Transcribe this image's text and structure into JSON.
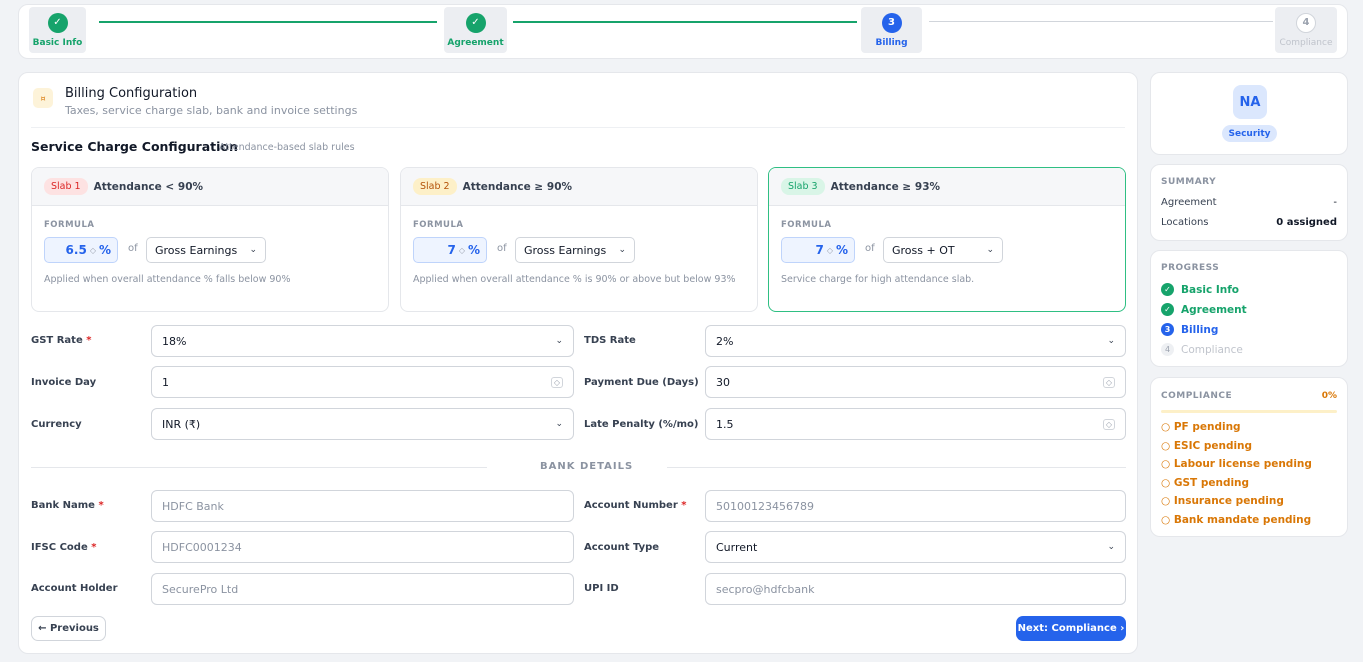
{
  "steps": [
    {
      "num": "✓",
      "label": "Basic Info",
      "state": "done"
    },
    {
      "num": "✓",
      "label": "Agreement",
      "state": "done"
    },
    {
      "num": "3",
      "label": "Billing",
      "state": "active"
    },
    {
      "num": "4",
      "label": "Compliance",
      "state": "todo"
    }
  ],
  "header": {
    "icon": "¤",
    "title": "Billing Configuration",
    "subtitle": "Taxes, service charge slab, bank and invoice settings"
  },
  "service_charge": {
    "title": "Service Charge Configuration",
    "subtitle": "Attendance-based slab rules",
    "formula_label": "FORMULA",
    "of_label": "of",
    "slabs": [
      {
        "badge": "Slab 1",
        "condition": "Attendance < 90%",
        "percent": "6.5",
        "unit": "%",
        "base": "Gross Earnings",
        "description": "Applied when overall attendance % falls below 90%"
      },
      {
        "badge": "Slab 2",
        "condition": "Attendance ≥ 90%",
        "percent": "7",
        "unit": "%",
        "base": "Gross Earnings",
        "description": "Applied when overall attendance % is 90% or above but below 93%"
      },
      {
        "badge": "Slab 3",
        "condition": "Attendance ≥ 93%",
        "percent": "7",
        "unit": "%",
        "base": "Gross + OT",
        "description": "Service charge for high attendance slab."
      }
    ]
  },
  "fields": {
    "gst_rate": {
      "label": "GST Rate",
      "value": "18%"
    },
    "tds_rate": {
      "label": "TDS Rate",
      "value": "2%"
    },
    "invoice_day": {
      "label": "Invoice Day",
      "value": "1"
    },
    "payment_due": {
      "label": "Payment Due (Days)",
      "value": "30"
    },
    "currency": {
      "label": "Currency",
      "value": "INR (₹)"
    },
    "late_penalty": {
      "label": "Late Penalty (%/mo)",
      "value": "1.5"
    }
  },
  "bank": {
    "title": "BANK DETAILS",
    "bank_name": {
      "label": "Bank Name",
      "placeholder": "HDFC Bank"
    },
    "account_number": {
      "label": "Account Number",
      "placeholder": "50100123456789"
    },
    "ifsc": {
      "label": "IFSC Code",
      "placeholder": "HDFC0001234"
    },
    "account_type": {
      "label": "Account Type",
      "value": "Current"
    },
    "account_holder": {
      "label": "Account Holder",
      "placeholder": "SecurePro Ltd"
    },
    "upi": {
      "label": "UPI ID",
      "placeholder": "secpro@hdfcbank"
    }
  },
  "buttons": {
    "previous": "← Previous",
    "next": "Next: Compliance ›"
  },
  "sidebar": {
    "avatar": "NA",
    "role": "Security",
    "summary_title": "SUMMARY",
    "agreement_label": "Agreement",
    "agreement_value": "-",
    "locations_label": "Locations",
    "locations_value": "0 assigned",
    "progress_title": "PROGRESS",
    "progress": [
      {
        "num": "✓",
        "label": "Basic Info",
        "state": "done"
      },
      {
        "num": "✓",
        "label": "Agreement",
        "state": "done"
      },
      {
        "num": "3",
        "label": "Billing",
        "state": "active"
      },
      {
        "num": "4",
        "label": "Compliance",
        "state": "todo"
      }
    ],
    "compliance_title": "COMPLIANCE",
    "compliance_percent": "0%",
    "compliance_fraction": 0,
    "compliance_items": [
      "PF pending",
      "ESIC pending",
      "Labour license pending",
      "GST pending",
      "Insurance pending",
      "Bank mandate pending"
    ]
  },
  "colors": {
    "primary": "#2563eb",
    "success": "#16a36b",
    "warning": "#d97706",
    "danger": "#dc2626"
  }
}
